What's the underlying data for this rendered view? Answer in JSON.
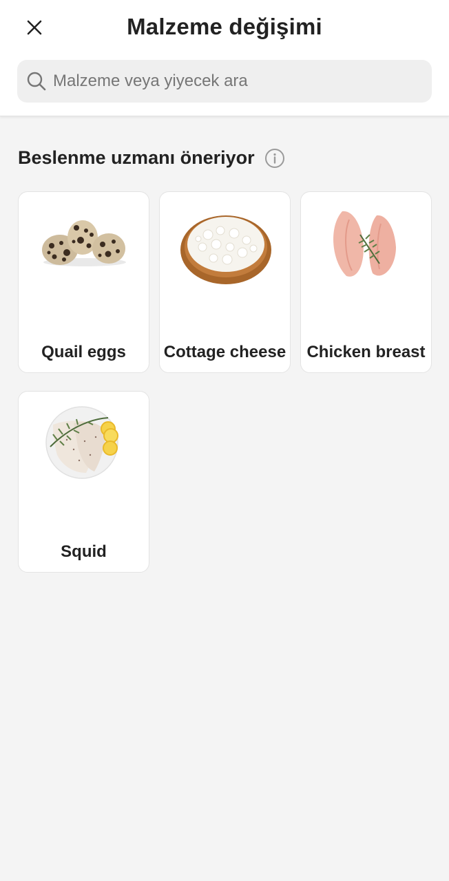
{
  "header": {
    "title": "Malzeme değişimi",
    "close_icon": "close-icon"
  },
  "search": {
    "placeholder": "Malzeme veya yiyecek ara",
    "value": "",
    "icon": "search-icon"
  },
  "section": {
    "title": "Beslenme uzmanı öneriyor",
    "info_icon": "info-icon"
  },
  "items": [
    {
      "label": "Quail eggs",
      "image": "quail-eggs-image"
    },
    {
      "label": "Cottage cheese",
      "image": "cottage-cheese-image"
    },
    {
      "label": "Chicken breast",
      "image": "chicken-breast-image"
    },
    {
      "label": "Squid",
      "image": "squid-image"
    }
  ],
  "colors": {
    "background": "#f4f4f4",
    "card": "#ffffff",
    "search_bg": "#efefef",
    "text": "#222222",
    "placeholder": "#767676"
  }
}
